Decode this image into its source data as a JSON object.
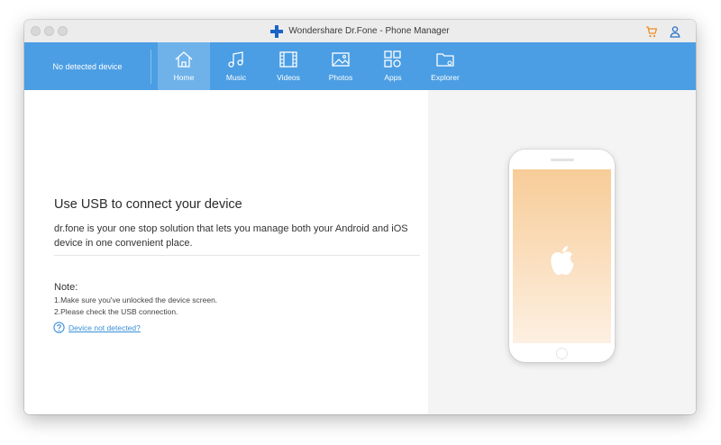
{
  "window": {
    "title": "Wondershare Dr.Fone - Phone Manager"
  },
  "titlebar": {
    "cart_icon": "shopping-cart-icon",
    "account_icon": "user-icon"
  },
  "sidebar": {
    "device_status": "No detected device"
  },
  "nav": {
    "tabs": [
      {
        "label": "Home",
        "icon": "home-icon",
        "active": true
      },
      {
        "label": "Music",
        "icon": "music-icon",
        "active": false
      },
      {
        "label": "Videos",
        "icon": "film-icon",
        "active": false
      },
      {
        "label": "Photos",
        "icon": "image-icon",
        "active": false
      },
      {
        "label": "Apps",
        "icon": "apps-icon",
        "active": false
      },
      {
        "label": "Explorer",
        "icon": "folder-icon",
        "active": false
      }
    ]
  },
  "main": {
    "heading": "Use USB to connect your device",
    "description": "dr.fone is your one stop solution that lets you manage both your Android and iOS device in one convenient place.",
    "note_title": "Note:",
    "notes": [
      "1.Make sure you've unlocked the device screen.",
      "2.Please check the USB connection."
    ],
    "help_link": "Device not detected?"
  },
  "colors": {
    "nav_bg": "#4b9ee3",
    "nav_active": "#6fb2ea",
    "brand_cross": "#1a63c7",
    "cart_orange": "#f08a24",
    "link": "#3a8fd8",
    "screen_top": "#f7cc98",
    "screen_bottom": "#fdf0e2"
  }
}
